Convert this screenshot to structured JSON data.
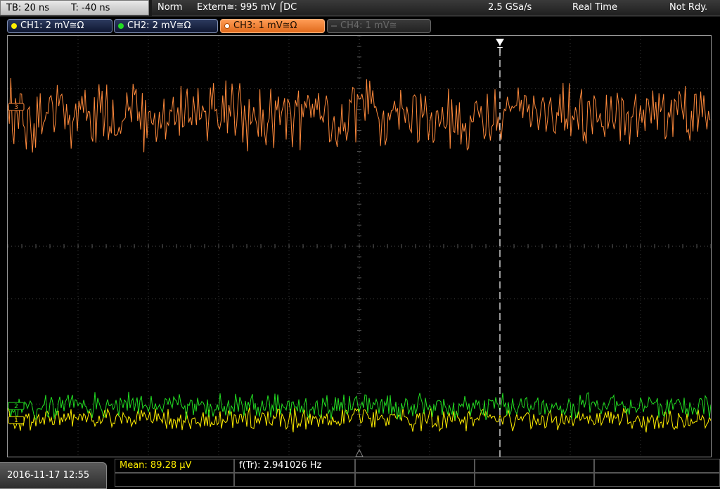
{
  "topbar": {
    "timebase": "TB: 20 ns",
    "trigger_time": "T: -40 ns",
    "trigger_mode": "Norm",
    "trigger_source": "Extern≅: 995 mV ⌠DC",
    "sample_rate": "2.5 GSa/s",
    "acq_mode": "Real Time",
    "status": "Not Rdy."
  },
  "channels": [
    {
      "label": "CH1: 2 mV≅Ω",
      "color": "#ffee00",
      "state": "on"
    },
    {
      "label": "CH2: 2 mV≅Ω",
      "color": "#22dd22",
      "state": "on"
    },
    {
      "label": "CH3: 1 mV≅Ω",
      "color": "#ff8a3c",
      "state": "active"
    },
    {
      "label": "CH4: 1 mV≅",
      "color": "#777777",
      "state": "off"
    }
  ],
  "screen": {
    "trigger_marker": "T",
    "ch_markers": [
      "1",
      "2",
      "3"
    ]
  },
  "bottombar": {
    "datetime": "2016-11-17 12:55",
    "mean_label": "Mean: 89.28 µV",
    "freq_label": "f(Tr): 2.941026 Hz"
  },
  "colors": {
    "ch1": "#ffee00",
    "ch2": "#22dd22",
    "ch3": "#ff8a3c",
    "grid": "#3c3c3c",
    "trigger": "#ffffff"
  }
}
